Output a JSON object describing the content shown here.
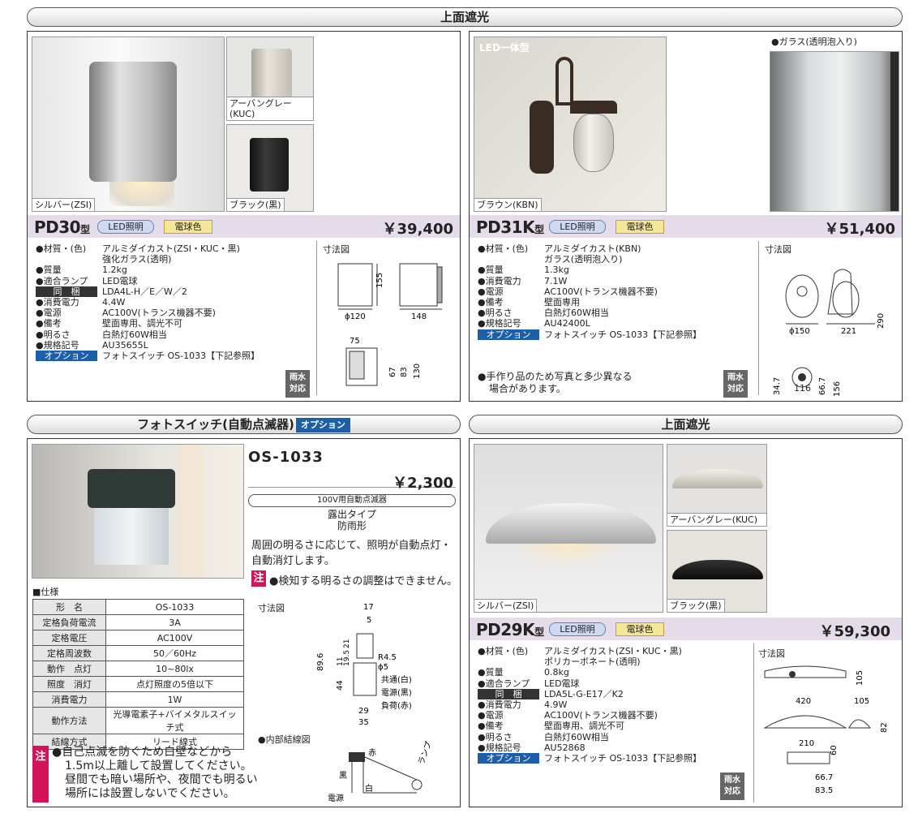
{
  "sections": {
    "top_title": "上面遮光",
    "photo_title": "フォトスイッチ(自動点滅器)",
    "photo_title_option": "オプション",
    "bottom_right_title": "上面遮光"
  },
  "pd30": {
    "model": "PD30",
    "model_suffix": "型",
    "led": "LED照明",
    "color": "電球色",
    "price": "￥39,400",
    "captions": {
      "main": "シルバー(ZSI)",
      "gray": "アーバングレー(KUC)",
      "black": "ブラック(黒)"
    },
    "specs": [
      {
        "k": "●材質・(色)",
        "v": "アルミダイカスト(ZSI・KUC・黒)"
      },
      {
        "k": "",
        "v": "強化ガラス(透明)"
      },
      {
        "k": "●質量",
        "v": "1.2kg"
      },
      {
        "k": "●適合ランプ",
        "v": "LED電球"
      },
      {
        "k": "同　梱",
        "v": "LDA4L-H／E／W／2",
        "type": "hl"
      },
      {
        "k": "●消費電力",
        "v": "4.4W"
      },
      {
        "k": "●電源",
        "v": "AC100V(トランス機器不要)"
      },
      {
        "k": "●備考",
        "v": "壁面専用、調光不可"
      },
      {
        "k": "●明るさ",
        "v": "白熱灯60W相当"
      },
      {
        "k": "●規格記号",
        "v": "AU35655L"
      },
      {
        "k": "オプション",
        "v": "フォトスイッチ OS-1033【下記参照】",
        "type": "opt"
      }
    ],
    "dim_title": "寸法図",
    "dims": {
      "h": "155",
      "d": "ϕ120",
      "w": "148",
      "a": "75",
      "b": "67",
      "c": "83",
      "e": "130"
    },
    "badge": "雨水\n対応"
  },
  "pd31k": {
    "model": "PD31K",
    "model_suffix": "型",
    "led": "LED照明",
    "color": "電球色",
    "price": "￥51,400",
    "tag": "LED一体型",
    "glass_label": "●ガラス(透明泡入り)",
    "caption": "ブラウン(KBN)",
    "specs": [
      {
        "k": "●材質・(色)",
        "v": "アルミダイカスト(KBN)"
      },
      {
        "k": "",
        "v": "ガラス(透明泡入り)"
      },
      {
        "k": "●質量",
        "v": "1.3kg"
      },
      {
        "k": "●消費電力",
        "v": "7.1W"
      },
      {
        "k": "●電源",
        "v": "AC100V(トランス機器不要)"
      },
      {
        "k": "●備考",
        "v": "壁面専用"
      },
      {
        "k": "●明るさ",
        "v": "白熱灯60W相当"
      },
      {
        "k": "●規格記号",
        "v": "AU42400L"
      },
      {
        "k": "オプション",
        "v": "フォトスイッチ OS-1033【下記参照】",
        "type": "opt"
      }
    ],
    "note1": "●手作り品のため写真と多少異なる",
    "note2": "場合があります。",
    "dim_title": "寸法図",
    "dims": {
      "d": "ϕ150",
      "w": "221",
      "h": "290",
      "a": "34.7",
      "b": "66.7",
      "c": "156",
      "e": "116"
    },
    "badge": "雨水\n対応"
  },
  "os1033": {
    "model": "OS-1033",
    "price": "￥2,300",
    "box": "100V用自動点滅器",
    "type1": "露出タイプ",
    "type2": "防雨形",
    "desc1": "周囲の明るさに応じて、照明が自動点灯・",
    "desc2": "自動消灯します。",
    "note_tag": "注",
    "note": "●検知する明るさの調整はできません。",
    "spec_title": "■仕様",
    "table": [
      [
        "形　名",
        "OS-1033"
      ],
      [
        "定格負荷電流",
        "3A"
      ],
      [
        "定格電圧",
        "AC100V"
      ],
      [
        "定格周波数",
        "50／60Hz"
      ],
      [
        "動作　点灯",
        "10~80lx"
      ],
      [
        "照度　消灯",
        "点灯照度の5倍以下"
      ],
      [
        "消費電力",
        "1W"
      ],
      [
        "動作方法",
        "光導電素子+バイメタルスイッチ式"
      ],
      [
        "結線方式",
        "リード線式"
      ]
    ],
    "warn_tag": "注",
    "warn_lines": [
      "●自己点滅を防ぐため白壁などから",
      "1.5m以上離して設置してください。",
      "昼間でも暗い場所や、夜間でも明るい",
      "場所には設置しないでください。"
    ],
    "dim_title": "寸法図",
    "wiring_title": "●内部結線図",
    "dims": {
      "top": "17",
      "a": "5",
      "b": "21",
      "c": "19.5",
      "d": "11",
      "e": "89.6",
      "f": "44",
      "g": "29",
      "h": "35",
      "r": "R4.5",
      "p": "ϕ5"
    },
    "wires": {
      "common": "共通(白)",
      "power": "電源(黒)",
      "load": "負荷(赤)"
    },
    "wiring": {
      "lamp": "ランプ",
      "red": "赤",
      "black": "黒",
      "white": "白",
      "source": "電源"
    }
  },
  "pd29k": {
    "model": "PD29K",
    "model_suffix": "型",
    "led": "LED照明",
    "color": "電球色",
    "price": "￥59,300",
    "captions": {
      "main": "シルバー(ZSI)",
      "gray": "アーバングレー(KUC)",
      "black": "ブラック(黒)"
    },
    "specs": [
      {
        "k": "●材質・(色)",
        "v": "アルミダイカスト(ZSI・KUC・黒)"
      },
      {
        "k": "",
        "v": "ポリカーボネート(透明)"
      },
      {
        "k": "●質量",
        "v": "0.8kg"
      },
      {
        "k": "●適合ランプ",
        "v": "LED電球"
      },
      {
        "k": "同　梱",
        "v": "LDA5L-G-E17／K2",
        "type": "hl"
      },
      {
        "k": "●消費電力",
        "v": "4.9W"
      },
      {
        "k": "●電源",
        "v": "AC100V(トランス機器不要)"
      },
      {
        "k": "●備考",
        "v": "壁面専用、調光不可"
      },
      {
        "k": "●明るさ",
        "v": "白熱灯60W相当"
      },
      {
        "k": "●規格記号",
        "v": "AU52868"
      },
      {
        "k": "オプション",
        "v": "フォトスイッチ OS-1033【下記参照】",
        "type": "opt"
      }
    ],
    "dim_title": "寸法図",
    "dims": {
      "h": "105",
      "w": "420",
      "d": "105",
      "e": "82",
      "a": "210",
      "b": "60",
      "c": "66.7",
      "f": "83.5"
    },
    "badge": "雨水\n対応"
  }
}
